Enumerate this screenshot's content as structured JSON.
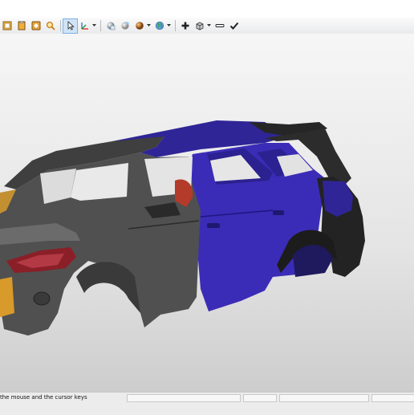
{
  "toolbar": {
    "tools": [
      "layout-icon",
      "paste-icon",
      "settings-icon",
      "zoom-icon",
      "select-cursor-icon",
      "move-gizmo-icon",
      "material-sphere-icon",
      "light-sphere-icon",
      "render-sphere-icon",
      "globe-icon",
      "add-icon",
      "view-cube-icon",
      "minus-icon",
      "check-icon"
    ],
    "active_tool": "select-cursor-icon"
  },
  "viewport": {
    "model": "SUV car body 3D model",
    "colors": {
      "body_gray": "#4a4a4a",
      "body_blue": "#3a29b8",
      "taillight": "#8a1f28",
      "interior": "#b83a2c"
    }
  },
  "status": {
    "hint": "the mouse and the cursor keys"
  }
}
